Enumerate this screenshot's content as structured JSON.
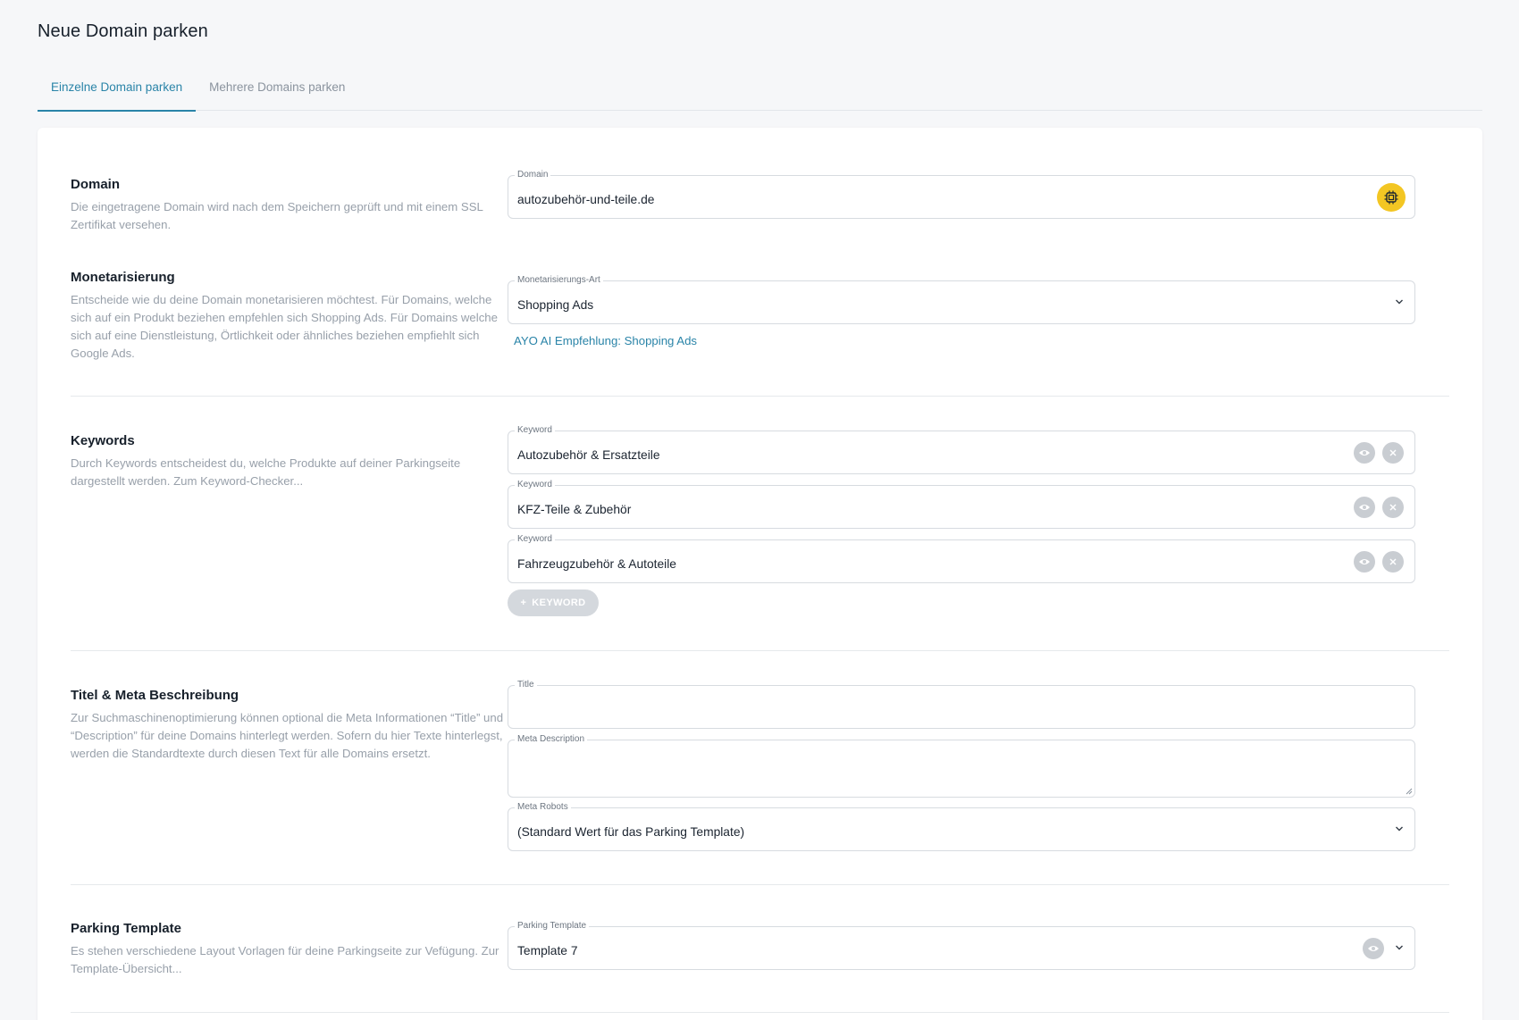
{
  "page": {
    "title": "Neue Domain parken"
  },
  "tabs": [
    {
      "label": "Einzelne Domain parken",
      "active": true
    },
    {
      "label": "Mehrere Domains parken",
      "active": false
    }
  ],
  "colors": {
    "accent": "#2a84a8",
    "ai_button": "#f3c623",
    "muted_text": "#98a0aa"
  },
  "domain_section": {
    "title": "Domain",
    "description": "Die eingetragene Domain wird nach dem Speichern geprüft und mit einem SSL Zertifikat versehen.",
    "field_label": "Domain",
    "field_value": "autozubehör-und-teile.de",
    "ai_icon": "cpu-chip-icon"
  },
  "monetization_section": {
    "title": "Monetarisierung",
    "description": "Entscheide wie du deine Domain monetarisieren möchtest. Für Domains, welche sich auf ein Produkt beziehen empfehlen sich Shopping Ads. Für Domains welche sich auf eine Dienstleistung, Örtlichkeit oder ähnliches beziehen empfiehlt sich Google Ads.",
    "field_label": "Monetarisierungs-Art",
    "field_value": "Shopping Ads",
    "ai_recommendation": "AYO AI Empfehlung: Shopping Ads"
  },
  "keywords_section": {
    "title": "Keywords",
    "description": "Durch Keywords entscheidest du, welche Produkte auf deiner Parkingseite dargestellt werden. Zum Keyword-Checker...",
    "keyword_label": "Keyword",
    "keywords": [
      {
        "value": "Autozubehör & Ersatzteile"
      },
      {
        "value": "KFZ-Teile & Zubehör"
      },
      {
        "value": "Fahrzeugzubehör & Autoteile"
      }
    ],
    "add_button_label": "KEYWORD"
  },
  "meta_section": {
    "title": "Titel & Meta Beschreibung",
    "description": "Zur Suchmaschinenoptimierung können optional die Meta Informationen “Title” und “Description” für deine Domains hinterlegt werden. Sofern du hier Texte hinterlegst, werden die Standardtexte durch diesen Text für alle Domains ersetzt.",
    "title_label": "Title",
    "title_value": "",
    "meta_description_label": "Meta Description",
    "meta_description_value": "",
    "meta_robots_label": "Meta Robots",
    "meta_robots_value": "(Standard Wert für das Parking Template)"
  },
  "template_section": {
    "title": "Parking Template",
    "description": "Es stehen verschiedene Layout Vorlagen für deine Parkingseite zur Vefügung. Zur Template-Übersicht...",
    "field_label": "Parking Template",
    "field_value": "Template 7"
  }
}
